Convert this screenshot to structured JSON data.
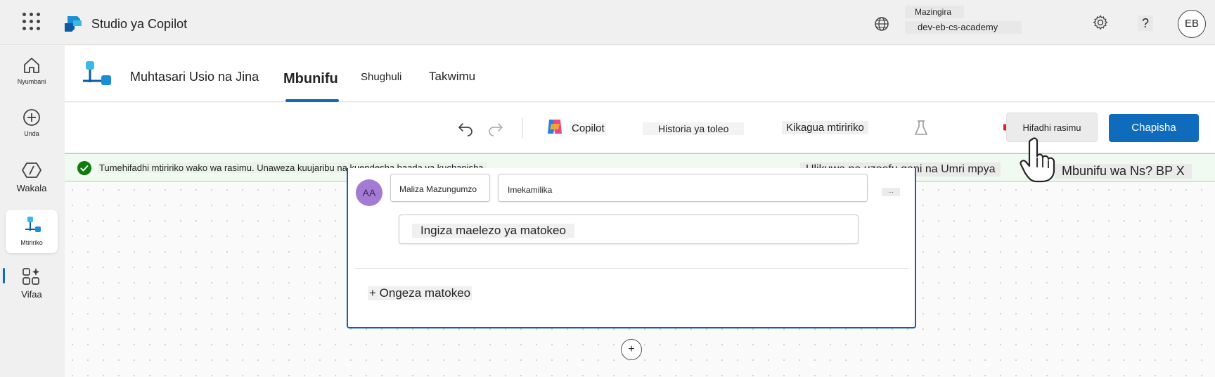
{
  "topbar": {
    "app_title": "Studio ya Copilot",
    "environment_label": "Mazingira",
    "environment_name": "dev-eb-cs-academy",
    "user_initials": "EB",
    "help_label": "?"
  },
  "sidebar": {
    "items": [
      {
        "label": "Nyumbani",
        "icon": "home-icon"
      },
      {
        "label": "Unda",
        "icon": "plus-circle-icon"
      },
      {
        "label": "Wakala",
        "icon": "agents-icon"
      },
      {
        "label": "Mtiririko",
        "icon": "flow-icon",
        "active": true
      },
      {
        "label": "Vifaa",
        "icon": "tools-icon"
      }
    ],
    "more_label": "..."
  },
  "header": {
    "agent_title": "Muhtasari Usio na Jina",
    "tabs": [
      {
        "label": "Mbunifu",
        "active": true
      },
      {
        "label": "Shughuli"
      },
      {
        "label": "Takwimu"
      }
    ]
  },
  "toolbar": {
    "copilot_label": "Copilot",
    "history_label": "Historia ya toleo",
    "checker_label": "Kikagua mtiririko",
    "save_label": "Hifadhi rasimu",
    "publish_label": "Chapisha"
  },
  "notification": {
    "message": "Tumehifadhi mtiririko wako wa rasimu. Unaweza kuujaribu na kuendesha baada ya kuchapisha.",
    "question": "Ulikuwa na uzoefu gani na Umri mpya",
    "right_text": "Mbunifu wa Ns? BP X"
  },
  "card": {
    "avatar_initials": "AA",
    "action_name": "Maliza Mazungumzo",
    "status_value": "Imekamilika",
    "more_label": "...",
    "outcome_placeholder": "Ingiza maelezo ya matokeo",
    "add_outcome_label": "+ Ongeza matokeo",
    "add_node_label": "+"
  },
  "colors": {
    "accent": "#0f6cbd",
    "success": "#107c10",
    "avatar": "#a37ad4",
    "arrow": "#e02020"
  }
}
